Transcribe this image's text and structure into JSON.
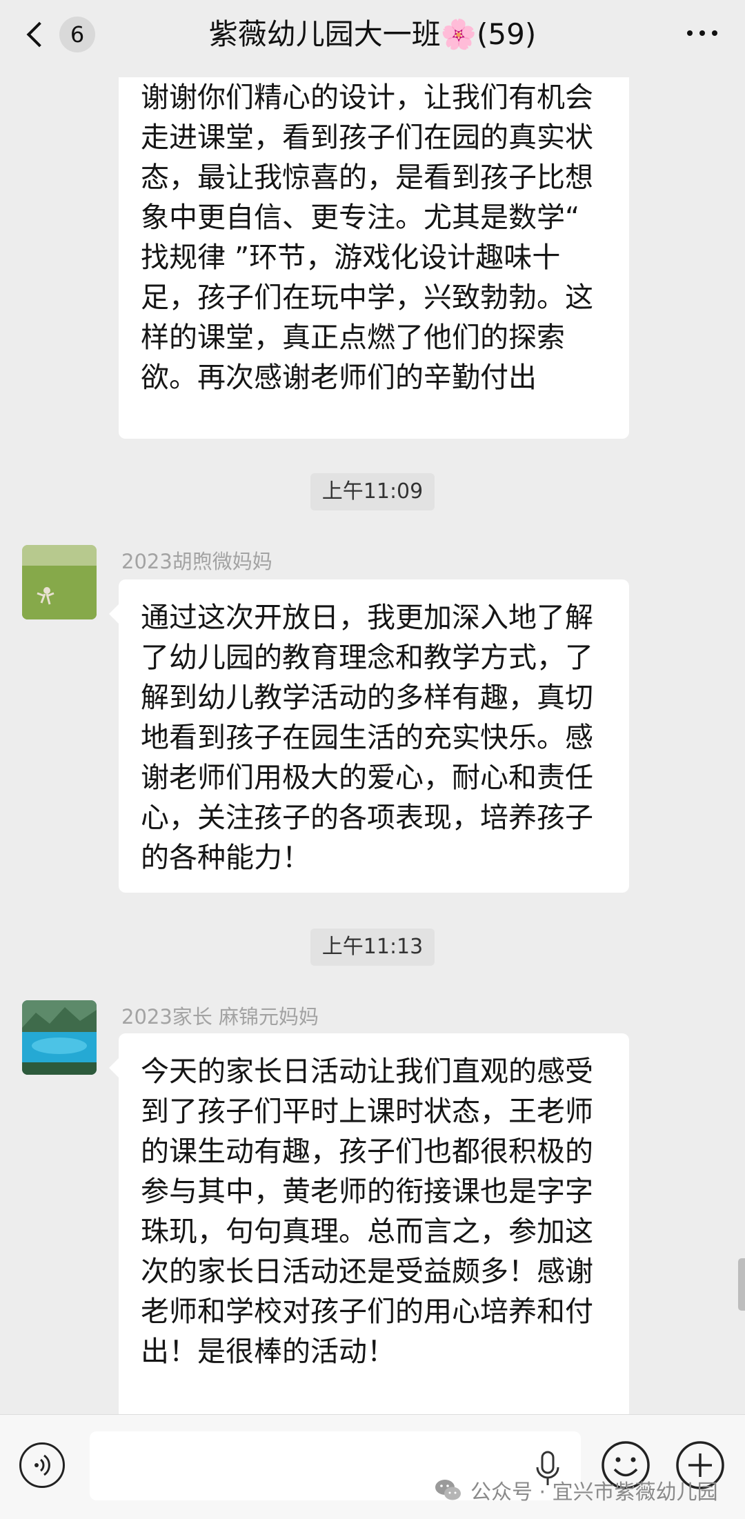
{
  "header": {
    "unread_count": "6",
    "title": "紫薇幼儿园大一班🌸(59)"
  },
  "messages": [
    {
      "text": "谢谢你们精心的设计，让我们有机会走进课堂，看到孩子们在园的真实状态，最让我惊喜的，是看到孩子比想象中更自信、更专注。尤其是数学“ 找规律 ”环节，游戏化设计趣味十足，孩子们在玩中学，兴致勃勃。这样的课堂，真正点燃了他们的探索欲。再次感谢老师们的辛勤付出"
    },
    {
      "timestamp": "上午11:09",
      "sender": "2023胡煦微妈妈",
      "text": "通过这次开放日，我更加深入地了解了幼儿园的教育理念和教学方式，了解到幼儿教学活动的多样有趣，真切地看到孩子在园生活的充实快乐。感谢老师们用极大的爱心，耐心和责任心，关注孩子的各项表现，培养孩子的各种能力！"
    },
    {
      "timestamp": "上午11:13",
      "sender": "2023家长 麻锦元妈妈",
      "text": "今天的家长日活动让我们直观的感受到了孩子们平时上课时状态，王老师的课生动有趣，孩子们也都很积极的参与其中，黄老师的衔接课也是字字珠玑，句句真理。总而言之，参加这次的家长日活动还是受益颇多！感谢老师和学校对孩子们的用心培养和付出！是很棒的活动！"
    }
  ],
  "input": {
    "value": "",
    "placeholder": ""
  },
  "watermark": {
    "text": "公众号 · 宜兴市紫薇幼儿园"
  },
  "icons": {
    "back": "chevron-left-icon",
    "more": "more-dots-icon",
    "voice": "voice-icon",
    "mic": "mic-icon",
    "emoji": "emoji-icon",
    "plus": "plus-icon",
    "wechat": "wechat-logo-icon"
  }
}
